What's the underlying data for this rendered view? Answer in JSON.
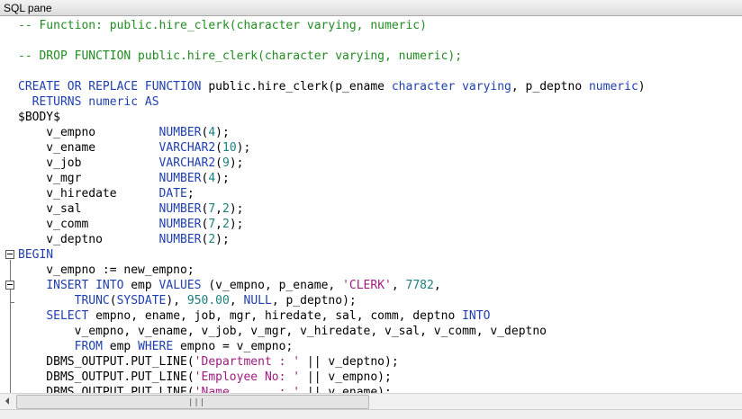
{
  "pane": {
    "title": "SQL pane"
  },
  "code": [
    [
      [
        "c",
        "-- Function: public.hire_clerk(character varying, numeric)"
      ]
    ],
    [],
    [
      [
        "c",
        "-- DROP FUNCTION public.hire_clerk(character varying, numeric);"
      ]
    ],
    [],
    [
      [
        "k",
        "CREATE OR REPLACE FUNCTION "
      ],
      [
        "p",
        "public.hire_clerk(p_ename "
      ],
      [
        "k",
        "character varying"
      ],
      [
        "p",
        ", p_deptno "
      ],
      [
        "k",
        "numeric"
      ],
      [
        "p",
        ")"
      ]
    ],
    [
      [
        "k",
        "  RETURNS numeric AS"
      ]
    ],
    [
      [
        "p",
        "$BODY$"
      ]
    ],
    [
      [
        "p",
        "    v_empno         "
      ],
      [
        "k",
        "NUMBER"
      ],
      [
        "p",
        "("
      ],
      [
        "n",
        "4"
      ],
      [
        "p",
        ");"
      ]
    ],
    [
      [
        "p",
        "    v_ename         "
      ],
      [
        "k",
        "VARCHAR2"
      ],
      [
        "p",
        "("
      ],
      [
        "n",
        "10"
      ],
      [
        "p",
        ");"
      ]
    ],
    [
      [
        "p",
        "    v_job           "
      ],
      [
        "k",
        "VARCHAR2"
      ],
      [
        "p",
        "("
      ],
      [
        "n",
        "9"
      ],
      [
        "p",
        ");"
      ]
    ],
    [
      [
        "p",
        "    v_mgr           "
      ],
      [
        "k",
        "NUMBER"
      ],
      [
        "p",
        "("
      ],
      [
        "n",
        "4"
      ],
      [
        "p",
        ");"
      ]
    ],
    [
      [
        "p",
        "    v_hiredate      "
      ],
      [
        "k",
        "DATE"
      ],
      [
        "p",
        ";"
      ]
    ],
    [
      [
        "p",
        "    v_sal           "
      ],
      [
        "k",
        "NUMBER"
      ],
      [
        "p",
        "("
      ],
      [
        "n",
        "7"
      ],
      [
        "p",
        ","
      ],
      [
        "n",
        "2"
      ],
      [
        "p",
        ");"
      ]
    ],
    [
      [
        "p",
        "    v_comm          "
      ],
      [
        "k",
        "NUMBER"
      ],
      [
        "p",
        "("
      ],
      [
        "n",
        "7"
      ],
      [
        "p",
        ","
      ],
      [
        "n",
        "2"
      ],
      [
        "p",
        ");"
      ]
    ],
    [
      [
        "p",
        "    v_deptno        "
      ],
      [
        "k",
        "NUMBER"
      ],
      [
        "p",
        "("
      ],
      [
        "n",
        "2"
      ],
      [
        "p",
        ");"
      ]
    ],
    [
      [
        "k",
        "BEGIN"
      ]
    ],
    [
      [
        "p",
        "    v_empno := new_empno;"
      ]
    ],
    [
      [
        "p",
        "    "
      ],
      [
        "k",
        "INSERT INTO "
      ],
      [
        "p",
        "emp "
      ],
      [
        "k",
        "VALUES "
      ],
      [
        "p",
        "(v_empno, p_ename, "
      ],
      [
        "s",
        "'CLERK'"
      ],
      [
        "p",
        ", "
      ],
      [
        "n",
        "7782"
      ],
      [
        "p",
        ","
      ]
    ],
    [
      [
        "p",
        "        "
      ],
      [
        "k",
        "TRUNC"
      ],
      [
        "p",
        "("
      ],
      [
        "k",
        "SYSDATE"
      ],
      [
        "p",
        "), "
      ],
      [
        "n",
        "950.00"
      ],
      [
        "p",
        ", "
      ],
      [
        "k",
        "NULL"
      ],
      [
        "p",
        ", p_deptno);"
      ]
    ],
    [
      [
        "p",
        "    "
      ],
      [
        "k",
        "SELECT "
      ],
      [
        "p",
        "empno, ename, job, mgr, hiredate, sal, comm, deptno "
      ],
      [
        "k",
        "INTO"
      ]
    ],
    [
      [
        "p",
        "        v_empno, v_ename, v_job, v_mgr, v_hiredate, v_sal, v_comm, v_deptno"
      ]
    ],
    [
      [
        "p",
        "        "
      ],
      [
        "k",
        "FROM "
      ],
      [
        "p",
        "emp "
      ],
      [
        "k",
        "WHERE "
      ],
      [
        "p",
        "empno = v_empno;"
      ]
    ],
    [
      [
        "p",
        "    DBMS_OUTPUT.PUT_LINE("
      ],
      [
        "s",
        "'Department : '"
      ],
      [
        "p",
        " || v_deptno);"
      ]
    ],
    [
      [
        "p",
        "    DBMS_OUTPUT.PUT_LINE("
      ],
      [
        "s",
        "'Employee No: '"
      ],
      [
        "p",
        " || v_empno);"
      ]
    ],
    [
      [
        "p",
        "    DBMS_OUTPUT.PUT_LINE("
      ],
      [
        "s",
        "'Name       : '"
      ],
      [
        "p",
        " || v_ename);"
      ]
    ]
  ],
  "scrollbar": {
    "grip": "|||"
  },
  "colors": {
    "comment": "#228b22",
    "keyword": "#1f3fb0",
    "number": "#1a7f7f",
    "string": "#a01b7e"
  }
}
